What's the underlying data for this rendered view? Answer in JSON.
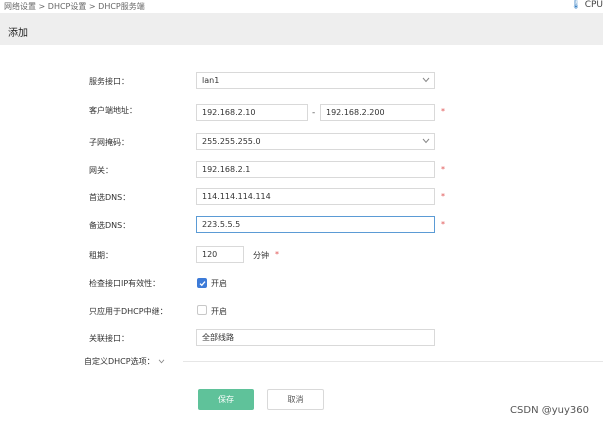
{
  "breadcrumb": "网络设置 > DHCP设置 > DHCP服务端",
  "cpu_label": "CPU",
  "section_title": "添加",
  "form": {
    "service_interface": {
      "label": "服务接口：",
      "value": "lan1"
    },
    "client_address": {
      "label": "客户端地址：",
      "start": "192.168.2.10",
      "dash": "-",
      "end": "192.168.2.200",
      "required": "*"
    },
    "subnet_mask": {
      "label": "子网掩码：",
      "value": "255.255.255.0"
    },
    "gateway": {
      "label": "网关：",
      "value": "192.168.2.1",
      "required": "*"
    },
    "primary_dns": {
      "label": "首选DNS：",
      "value": "114.114.114.114",
      "required": "*"
    },
    "secondary_dns": {
      "label": "备选DNS：",
      "value": "223.5.5.5",
      "required": "*"
    },
    "lease": {
      "label": "租期：",
      "value": "120",
      "unit": "分钟",
      "required": "*"
    },
    "check_ip": {
      "label": "检查接口IP有效性：",
      "checked": true,
      "option_label": "开启"
    },
    "relay_only": {
      "label": "只应用于DHCP中继：",
      "checked": false,
      "option_label": "开启"
    },
    "linked_interface": {
      "label": "关联接口：",
      "value": "全部线路"
    }
  },
  "custom_options_label": "自定义DHCP选项：",
  "buttons": {
    "save": "保存",
    "cancel": "取消"
  },
  "watermark": "CSDN @yuy360",
  "colors": {
    "save_button": "#5fc29a",
    "checkbox_checked": "#3d7bd8",
    "required": "#e05555",
    "focus_border": "#5b9bd5"
  },
  "icons": {
    "cpu": "thermometer-icon",
    "select": "chevron-down-icon",
    "check": "check-icon"
  }
}
